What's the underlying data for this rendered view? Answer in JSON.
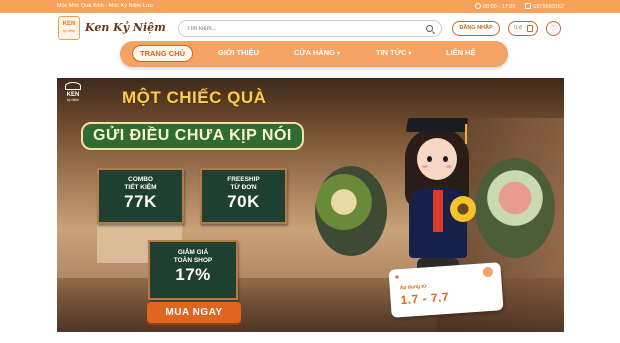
{
  "topbar": {
    "tagline": "Móc Móc Quà Xinh - Móc Kỷ Niệm Lưu",
    "hours": "08:00 - 17:00",
    "phone": "0975693162"
  },
  "header": {
    "logo_badge_text": "KEN",
    "logo_badge_sub": "ký niệm",
    "logo_text": "Ken Kỷ Niệm",
    "search_placeholder": "Tìm kiếm...",
    "login_label": "ĐĂNG NHẬP",
    "cart_label": "0 đ"
  },
  "nav": {
    "items": [
      {
        "label": "TRANG CHỦ",
        "active": true
      },
      {
        "label": "GIỚI THIỆU",
        "active": false
      },
      {
        "label": "CỬA HÀNG",
        "active": false,
        "dropdown": true
      },
      {
        "label": "TIN TỨC",
        "active": false,
        "dropdown": true
      },
      {
        "label": "LIÊN HỆ",
        "active": false
      }
    ],
    "chevron": "▾"
  },
  "banner": {
    "logo_text": "KEN",
    "logo_sub": "ký niệm",
    "headline_line1": "MỘT CHIẾC QUÀ",
    "headline_line2": "GỬI ĐIỀU CHƯA KỊP NÓI",
    "offers": [
      {
        "caption_1": "COMBO",
        "caption_2": "TIẾT KIỆM",
        "value": "77K"
      },
      {
        "caption_1": "FREESHIP",
        "caption_2": "TỪ ĐƠN",
        "value": "70K"
      },
      {
        "caption_1": "GIẢM GIÁ",
        "caption_2": "TOÀN SHOP",
        "value": "17%"
      }
    ],
    "cta_label": "MUA NGAY",
    "card_title": "Áp dụng từ",
    "card_dates": "1.7 - 7.7"
  },
  "colors": {
    "topbar_bg": "#f6a25a",
    "nav_bg": "#f3a464",
    "accent": "#d9612a",
    "board_bg": "#1f3f30",
    "cta_bg": "#e0651f"
  },
  "icons": [
    "clock-icon",
    "phone-icon",
    "search-icon",
    "cart-icon",
    "heart-icon",
    "chevron-down-icon",
    "bow-icon"
  ]
}
